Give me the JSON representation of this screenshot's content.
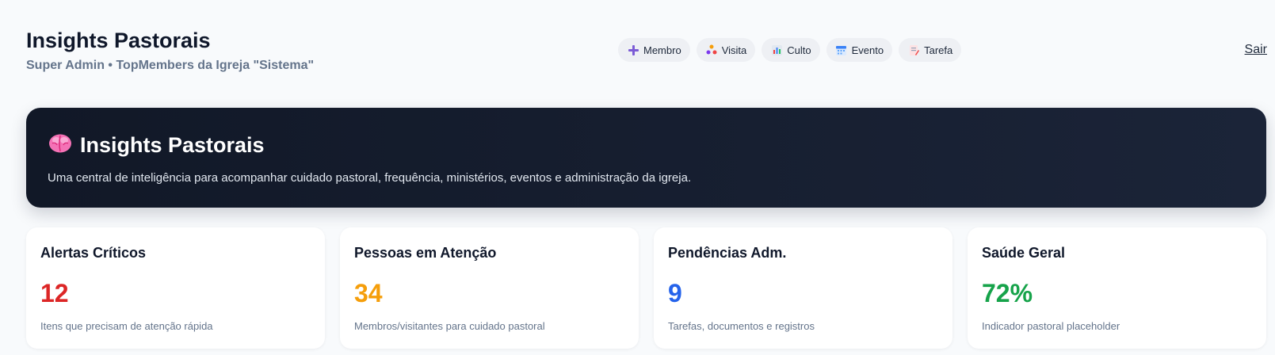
{
  "header": {
    "title": "Insights Pastorais",
    "subtitle": "Super Admin • TopMembers da Igreja \"Sistema\""
  },
  "quick_actions": [
    {
      "label": "Membro",
      "icon": "plus-icon"
    },
    {
      "label": "Visita",
      "icon": "people-icon"
    },
    {
      "label": "Culto",
      "icon": "bar-chart-icon"
    },
    {
      "label": "Evento",
      "icon": "calendar-icon"
    },
    {
      "label": "Tarefa",
      "icon": "memo-icon"
    }
  ],
  "logout_label": "Sair",
  "hero": {
    "icon": "brain-icon",
    "title": "Insights Pastorais",
    "description": "Uma central de inteligência para acompanhar cuidado pastoral, frequência, ministérios, eventos e administração da igreja."
  },
  "cards": [
    {
      "title": "Alertas Críticos",
      "value": "12",
      "description": "Itens que precisam de atenção rápida",
      "color": "#dc2626"
    },
    {
      "title": "Pessoas em Atenção",
      "value": "34",
      "description": "Membros/visitantes para cuidado pastoral",
      "color": "#f59e0b"
    },
    {
      "title": "Pendências Adm.",
      "value": "9",
      "description": "Tarefas, documentos e registros",
      "color": "#2563eb"
    },
    {
      "title": "Saúde Geral",
      "value": "72%",
      "description": "Indicador pastoral placeholder",
      "color": "#16a34a"
    }
  ]
}
